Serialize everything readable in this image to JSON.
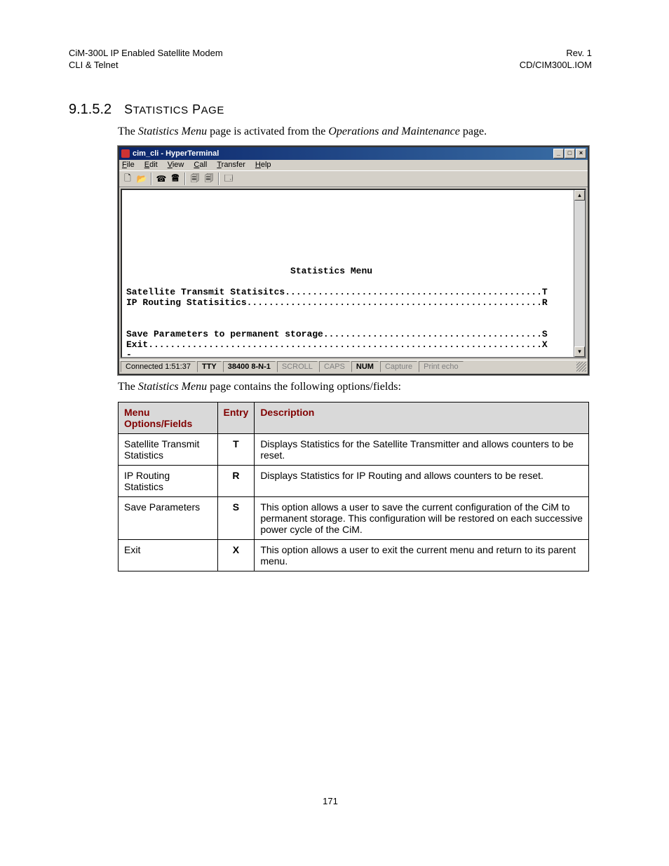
{
  "header": {
    "left_line1": "CiM-300L IP Enabled Satellite Modem",
    "left_line2": "CLI & Telnet",
    "right_line1": "Rev. 1",
    "right_line2": "CD/CIM300L.IOM"
  },
  "section": {
    "number": "9.1.5.2",
    "title_word1_first": "S",
    "title_word1_rest": "TATISTICS",
    "title_word2_first": "P",
    "title_word2_rest": "AGE"
  },
  "intro_pre": "The ",
  "intro_em1": "Statistics Menu",
  "intro_mid": " page is activated from the ",
  "intro_em2": "Operations and Maintenance",
  "intro_post": " page.",
  "win": {
    "title": "cim_cli - HyperTerminal",
    "menu": [
      "File",
      "Edit",
      "View",
      "Call",
      "Transfer",
      "Help"
    ],
    "btn_min": "_",
    "btn_max": "□",
    "btn_close": "×",
    "scroll_up": "▴",
    "scroll_down": "▾"
  },
  "terminal_text": "\n\n\n\n\n\n\n                              Statistics Menu\n\nSatellite Transmit Statisitcs...............................................T\nIP Routing Statisitics......................................................R\n\n\nSave Parameters to permanent storage........................................S\nExit........................................................................X\n-",
  "status": {
    "connected": "Connected 1:51:37",
    "tty": "TTY",
    "baud": "38400 8-N-1",
    "scroll": "SCROLL",
    "caps": "CAPS",
    "num": "NUM",
    "capture": "Capture",
    "echo": "Print echo"
  },
  "after_pre": "The ",
  "after_em": "Statistics Menu",
  "after_post": " page contains the following options/fields:",
  "table": {
    "headers": [
      "Menu Options/Fields",
      "Entry",
      "Description"
    ],
    "rows": [
      {
        "opt": "Satellite Transmit Statistics",
        "entry": "T",
        "desc": "Displays Statistics for the Satellite Transmitter and allows counters to be reset."
      },
      {
        "opt": "IP Routing Statistics",
        "entry": "R",
        "desc": "Displays Statistics for IP Routing and allows counters to be reset."
      },
      {
        "opt": "Save Parameters",
        "entry": "S",
        "desc": "This option allows a user to save the current configuration of the CiM to permanent storage. This configuration will be restored on each successive power cycle of the CiM."
      },
      {
        "opt": "Exit",
        "entry": "X",
        "desc": "This option allows a user to exit the current menu and return to its parent menu."
      }
    ]
  },
  "page_number": "171"
}
